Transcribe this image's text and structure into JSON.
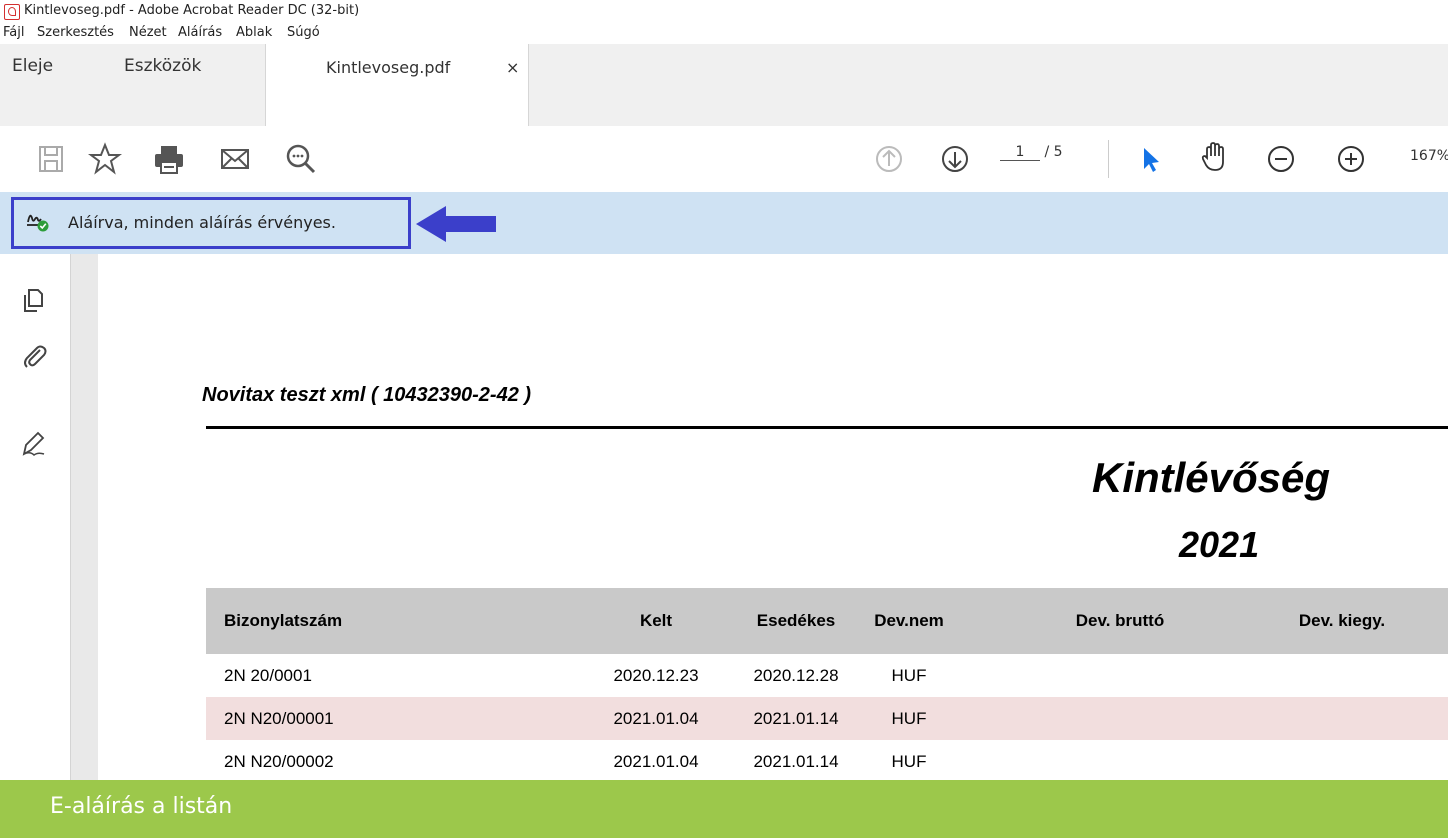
{
  "window": {
    "title": "Kintlevoseg.pdf - Adobe Acrobat Reader DC (32-bit)"
  },
  "menu": [
    "Fájl",
    "Szerkesztés",
    "Nézet",
    "Aláírás",
    "Ablak",
    "Súgó"
  ],
  "tabs": {
    "home": "Eleje",
    "tools": "Eszközök",
    "document": "Kintlevoseg.pdf",
    "close": "×"
  },
  "toolbar": {
    "page_current": "1",
    "page_total": "/ 5",
    "zoom": "167%"
  },
  "signature_bar": {
    "message": "Aláírva, minden aláírás érvényes."
  },
  "document": {
    "header": "Novitax teszt xml ( 10432390-2-42 )",
    "title": "Kintlévőség",
    "year": "2021",
    "columns": [
      "Bizonylatszám",
      "Kelt",
      "Esedékes",
      "Dev.nem",
      "Dev. bruttó",
      "Dev. kiegy."
    ],
    "rows": [
      [
        "2N 20/0001",
        "2020.12.23",
        "2020.12.28",
        "HUF",
        "",
        ""
      ],
      [
        "2N N20/00001",
        "2021.01.04",
        "2021.01.14",
        "HUF",
        "",
        ""
      ],
      [
        "2N N20/00002",
        "2021.01.04",
        "2021.01.14",
        "HUF",
        "",
        ""
      ]
    ]
  },
  "caption": "E-aláírás a listán",
  "colors": {
    "signature_bar": "#cfe2f3",
    "highlight_box": "#3b3fca",
    "caption_bg": "#9cc84b",
    "table_header": "#c9c9c9",
    "row_alt": "#f2dede"
  }
}
